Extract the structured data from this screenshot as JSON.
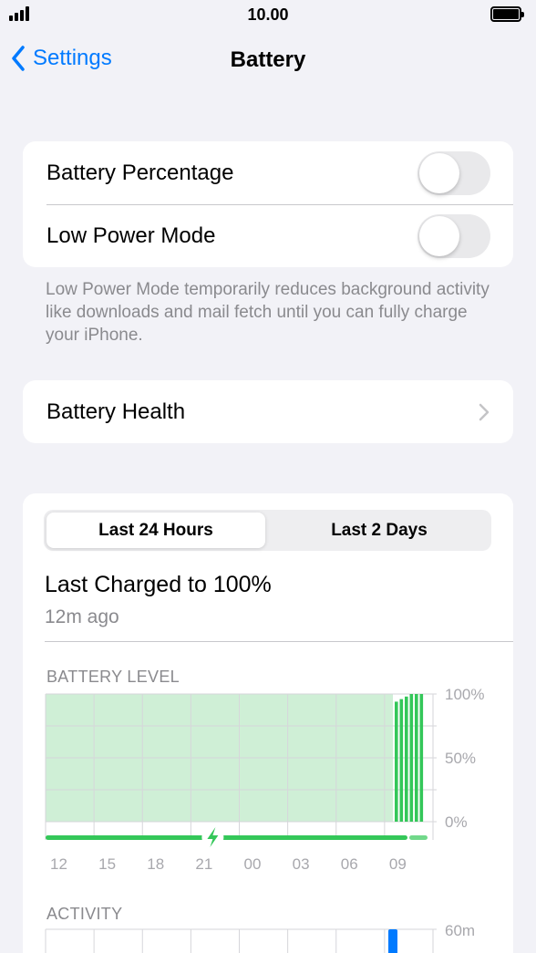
{
  "status_bar": {
    "time": "10.00"
  },
  "nav": {
    "back_label": "Settings",
    "title": "Battery"
  },
  "toggles": [
    {
      "label": "Battery Percentage",
      "on": false
    },
    {
      "label": "Low Power Mode",
      "on": false
    }
  ],
  "low_power_footnote": "Low Power Mode temporarily reduces background activity like downloads and mail fetch until you can fully charge your iPhone.",
  "battery_health": {
    "label": "Battery Health"
  },
  "usage": {
    "segments": [
      "Last 24 Hours",
      "Last 2 Days"
    ],
    "selected_segment": "Last 24 Hours",
    "last_charged": "Last Charged to 100%",
    "last_charged_ago": "12m ago",
    "battery_level_caption": "BATTERY LEVEL",
    "activity_caption": "ACTIVITY"
  },
  "colors": {
    "accent": "#007aff",
    "battery_green": "#34c759",
    "battery_fill": "#cfefd6"
  },
  "chart_data": [
    {
      "type": "area",
      "title": "BATTERY LEVEL",
      "x_tick_labels": [
        "12",
        "15",
        "18",
        "21",
        "00",
        "03",
        "06",
        "09"
      ],
      "y_tick_labels": [
        "100%",
        "50%",
        "0%"
      ],
      "ylim": [
        0,
        100
      ],
      "grid": true,
      "series": [
        {
          "values_percent": [
            100,
            100,
            100,
            100,
            100,
            100,
            100,
            100,
            100,
            100,
            100,
            100,
            100,
            100,
            100,
            100,
            100,
            100,
            100,
            100,
            100,
            100,
            100,
            100
          ]
        }
      ],
      "charging_bars_percent": [
        94,
        96,
        98,
        100,
        100,
        100
      ],
      "charging_indicator": true
    },
    {
      "type": "bar",
      "title": "ACTIVITY",
      "y_tick_labels": [
        "60m"
      ],
      "ylim": [
        0,
        60
      ],
      "grid": true
    }
  ]
}
